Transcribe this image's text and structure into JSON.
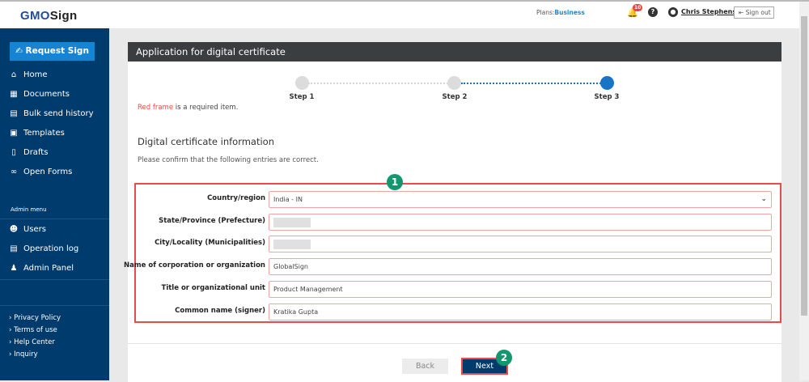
{
  "header": {
    "logo": "GMOSign",
    "plans_label": "Plans:",
    "plans_value": "Business",
    "notif_count": "10",
    "user": "Chris Stephens",
    "sign_out": "Sign out"
  },
  "sidebar": {
    "request_sign": "Request Sign",
    "items": [
      {
        "label": "Home"
      },
      {
        "label": "Documents"
      },
      {
        "label": "Bulk send history"
      },
      {
        "label": "Templates"
      },
      {
        "label": "Drafts"
      },
      {
        "label": "Open Forms"
      }
    ],
    "admin_label": "Admin menu",
    "admin_items": [
      {
        "label": "Users"
      },
      {
        "label": "Operation log"
      },
      {
        "label": "Admin Panel"
      }
    ],
    "footer_links": [
      "Privacy Policy",
      "Terms of use",
      "Help Center",
      "Inquiry"
    ]
  },
  "main": {
    "title": "Application for digital certificate",
    "steps": [
      "Step 1",
      "Step 2",
      "Step 3"
    ],
    "current_step": 3,
    "required_red": "Red frame",
    "required_rest": " is a required item.",
    "section_title": "Digital certificate information",
    "section_sub": "Please confirm that the following entries are correct.",
    "fields": [
      {
        "label": "Country/region",
        "value": "India - IN"
      },
      {
        "label": "State/Province (Prefecture)",
        "value": ""
      },
      {
        "label": "City/Locality (Municipalities)",
        "value": ""
      },
      {
        "label": "Name of corporation or organization",
        "value": "GlobalSign"
      },
      {
        "label": "Title or organizational unit",
        "value": "Product Management"
      },
      {
        "label": "Common name (signer)",
        "value": "Kratika Gupta"
      }
    ],
    "annotation_1": "1",
    "annotation_2": "2",
    "back": "Back",
    "next": "Next"
  },
  "colors": {
    "sidebar": "#003b6d",
    "accent": "#1783d4",
    "required": "#e94a4a",
    "annotation": "#13976f"
  }
}
